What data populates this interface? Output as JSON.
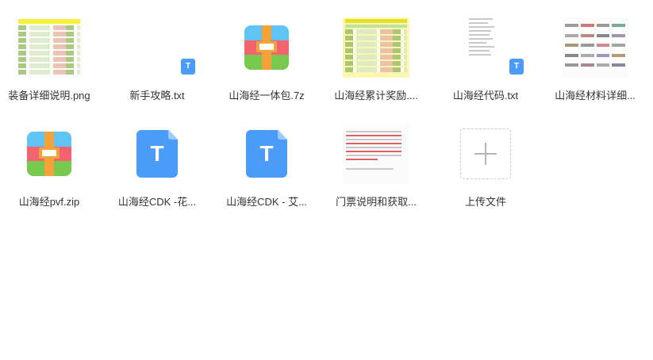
{
  "files": [
    {
      "name": "装备详细说明.png",
      "type": "image-sheet"
    },
    {
      "name": "新手攻略.txt",
      "type": "txt-small"
    },
    {
      "name": "山海经一体包.7z",
      "type": "archive"
    },
    {
      "name": "山海经累计奖励....",
      "type": "image-sheet-yellow"
    },
    {
      "name": "山海经代码.txt",
      "type": "txt-preview"
    },
    {
      "name": "山海经材料详细...",
      "type": "image-grid"
    },
    {
      "name": "山海经pvf.zip",
      "type": "archive"
    },
    {
      "name": "山海经CDK -花...",
      "type": "txt-big"
    },
    {
      "name": "山海经CDK - 艾...",
      "type": "txt-big"
    },
    {
      "name": "门票说明和获取...",
      "type": "image-doc"
    },
    {
      "name": "上传文件",
      "type": "upload"
    }
  ],
  "colors": {
    "txt_blue": "#4a9cf8",
    "archive_blue": "#5fc4f3",
    "archive_red": "#f3646f",
    "archive_green": "#7ac94f",
    "archive_orange": "#f6a23b"
  }
}
